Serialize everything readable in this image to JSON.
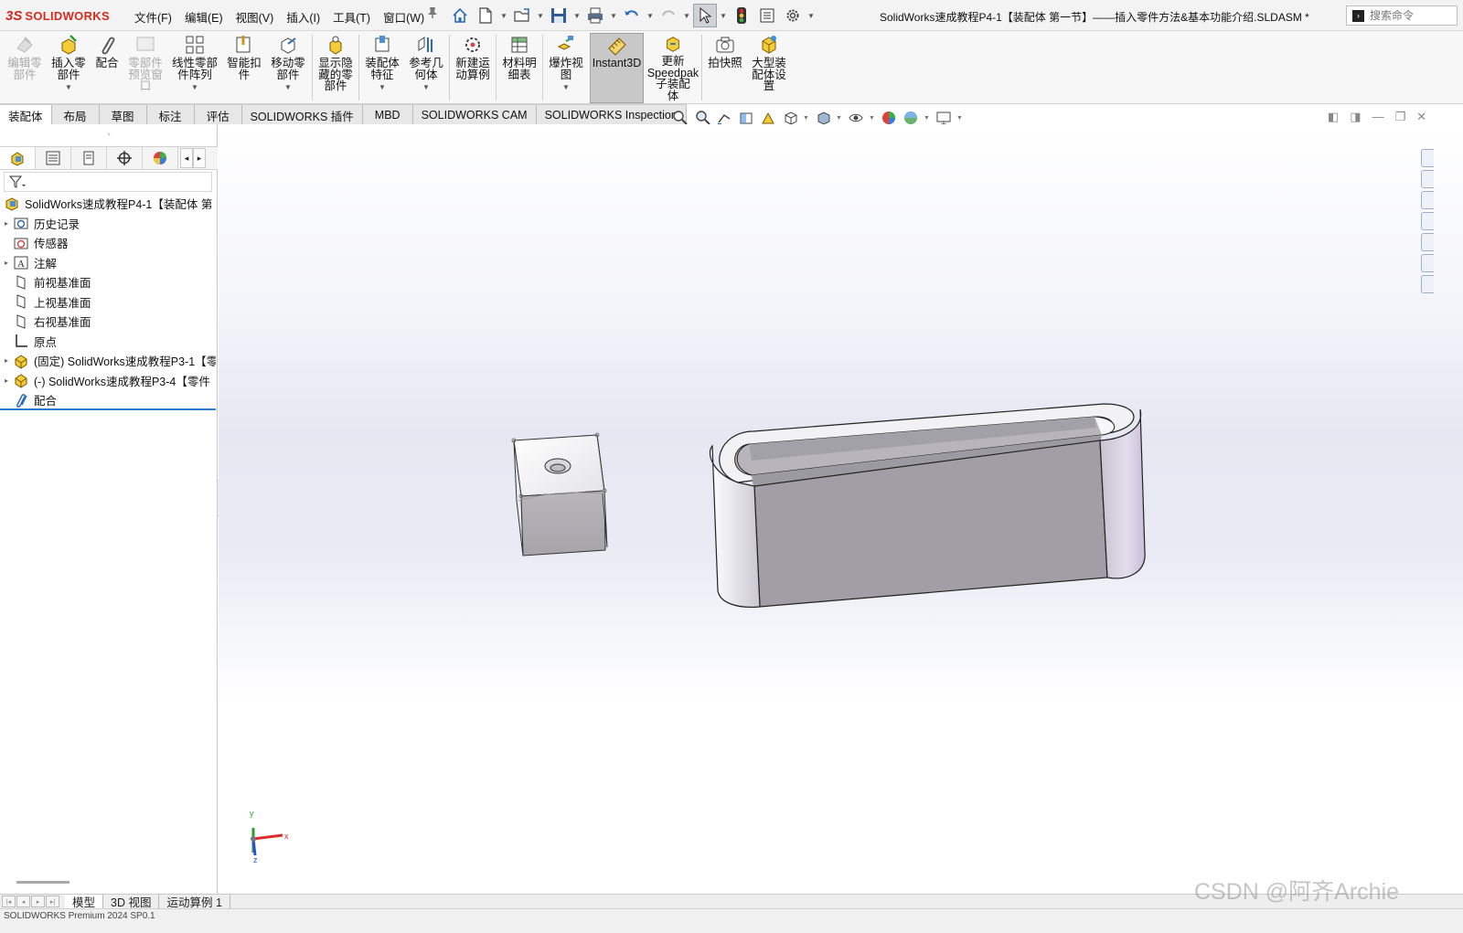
{
  "app": {
    "brand_ds": "3S",
    "brand_name": "SOLIDWORKS",
    "brand_color": "#d52b1e",
    "document_title": "SolidWorks速成教程P4-1【装配体  第一节】——插入零件方法&基本功能介绍.SLDASM *",
    "search_placeholder": "搜索命令"
  },
  "menu": [
    "文件(F)",
    "编辑(E)",
    "视图(V)",
    "插入(I)",
    "工具(T)",
    "窗口(W)"
  ],
  "quick_access_icons": [
    "home-icon",
    "new-document-icon",
    "open-icon",
    "save-icon",
    "print-icon",
    "undo-icon",
    "redo-icon",
    "select-arrow-icon",
    "traffic-light-icon",
    "options-list-icon",
    "settings-gear-icon"
  ],
  "ribbon": {
    "edit_component": "编辑零\n部件",
    "insert_component": "插入零\n部件",
    "mate": "配合",
    "component_preview": "零部件\n预览窗\n口",
    "linear_pattern": "线性零部\n件阵列",
    "smart_fasteners": "智能扣\n件",
    "move_component": "移动零\n部件",
    "show_hidden": "显示隐\n藏的零\n部件",
    "assembly_features": "装配体\n特征",
    "reference_geometry": "参考几\n何体",
    "new_motion_study": "新建运\n动算例",
    "bill_of_materials": "材料明\n细表",
    "exploded_view": "爆炸视\n图",
    "instant3d": "Instant3D",
    "update_speedpak": "更新\nSpeedpak\n子装配\n体",
    "snapshot": "拍快照",
    "large_assembly": "大型装\n配体设\n置"
  },
  "command_tabs": [
    "装配体",
    "布局",
    "草图",
    "标注",
    "评估",
    "SOLIDWORKS 插件",
    "MBD",
    "SOLIDWORKS CAM",
    "SOLIDWORKS Inspection"
  ],
  "tree": [
    {
      "label": "SolidWorks速成教程P4-1【装配体  第",
      "icon": "assembly-icon",
      "expand": ""
    },
    {
      "label": "历史记录",
      "icon": "history-folder-icon",
      "expand": "▸"
    },
    {
      "label": "传感器",
      "icon": "sensor-icon",
      "expand": ""
    },
    {
      "label": "注解",
      "icon": "annotation-icon",
      "expand": "▸"
    },
    {
      "label": "前视基准面",
      "icon": "plane-icon",
      "expand": ""
    },
    {
      "label": "上视基准面",
      "icon": "plane-icon",
      "expand": ""
    },
    {
      "label": "右视基准面",
      "icon": "plane-icon",
      "expand": ""
    },
    {
      "label": "原点",
      "icon": "origin-icon",
      "expand": ""
    },
    {
      "label": "(固定) SolidWorks速成教程P3-1【零",
      "icon": "part-icon",
      "expand": "▸"
    },
    {
      "label": "(-) SolidWorks速成教程P3-4【零件",
      "icon": "part-icon",
      "expand": "▸"
    },
    {
      "label": "配合",
      "icon": "mates-icon",
      "expand": ""
    }
  ],
  "bottom_tabs": [
    "模型",
    "3D 视图",
    "运动算例 1"
  ],
  "status": "SOLIDWORKS Premium 2024 SP0.1",
  "triad": {
    "x": "x",
    "y": "y",
    "z": "z"
  },
  "watermark": "CSDN @阿齐Archie"
}
